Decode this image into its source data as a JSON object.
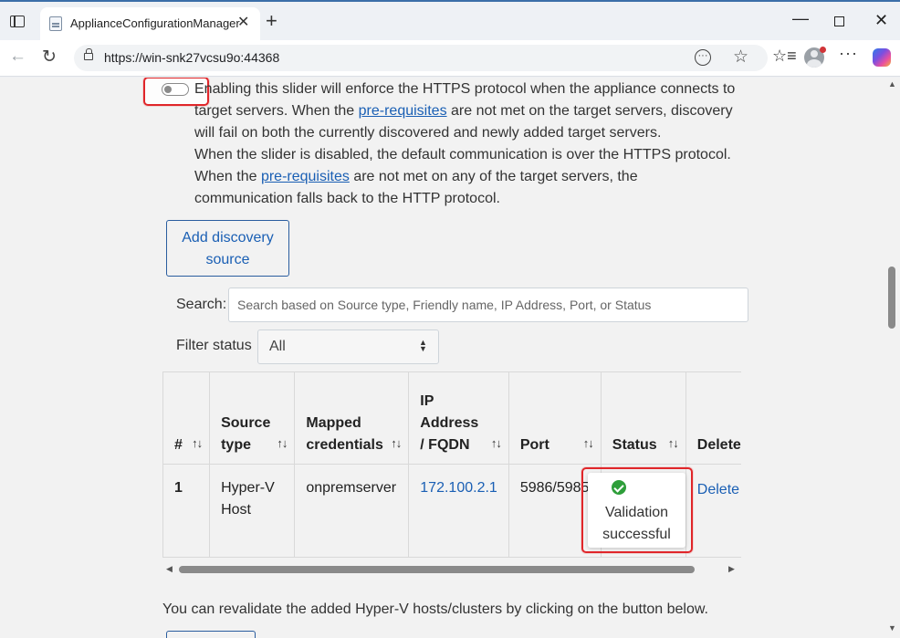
{
  "browser": {
    "tab_title": "ApplianceConfigurationManager",
    "tab_close": "✕",
    "new_tab": "+",
    "url": "https://win-snk27vcsu9o:44368",
    "win_min": "—",
    "win_close": "✕",
    "more": "···"
  },
  "toggle": {
    "state": "off"
  },
  "description": {
    "line1": "Enabling this slider will enforce the HTTPS protocol when the appliance connects to",
    "line2_pre": "target servers. When the ",
    "line2_link": "pre-requisites",
    "line2_post": " are not met on the target servers, discovery",
    "line3": "will fail on both the currently discovered and newly added target servers.",
    "line4": "When the slider is disabled, the default communication is over the HTTPS protocol.",
    "line5_pre": "When the ",
    "line5_link": "pre-requisites",
    "line5_post": " are not met on any of the target servers, the",
    "line6": "communication falls back to the HTTP protocol."
  },
  "add_discovery_source": {
    "line1": "Add discovery",
    "line2": "source"
  },
  "search": {
    "label": "Search:",
    "placeholder": "Search based on Source type, Friendly name, IP Address, Port, or Status"
  },
  "filter": {
    "label": "Filter status",
    "selected": "All"
  },
  "table": {
    "sort_glyph": "↑↓",
    "headers": {
      "num": "#",
      "source_type_1": "Source",
      "source_type_2": "type",
      "mapped_1": "Mapped",
      "mapped_2": "credentials",
      "ip_1": "IP",
      "ip_2": "Address",
      "ip_3": "/ FQDN",
      "port": "Port",
      "status": "Status",
      "delete": "Delete"
    },
    "rows": [
      {
        "num": "1",
        "source_type_1": "Hyper-V",
        "source_type_2": "Host",
        "mapped_credentials": "onpremserver",
        "ip": "172.100.2.1",
        "port": "5986/5985",
        "status_1": "Validation",
        "status_2": "successful",
        "delete": "Delete"
      }
    ]
  },
  "revalidate_text": "You can revalidate the added Hyper-V hosts/clusters by clicking on the button below.",
  "colors": {
    "link": "#1a5fb4",
    "highlight": "#e0262a",
    "success": "#2e9e3a"
  }
}
